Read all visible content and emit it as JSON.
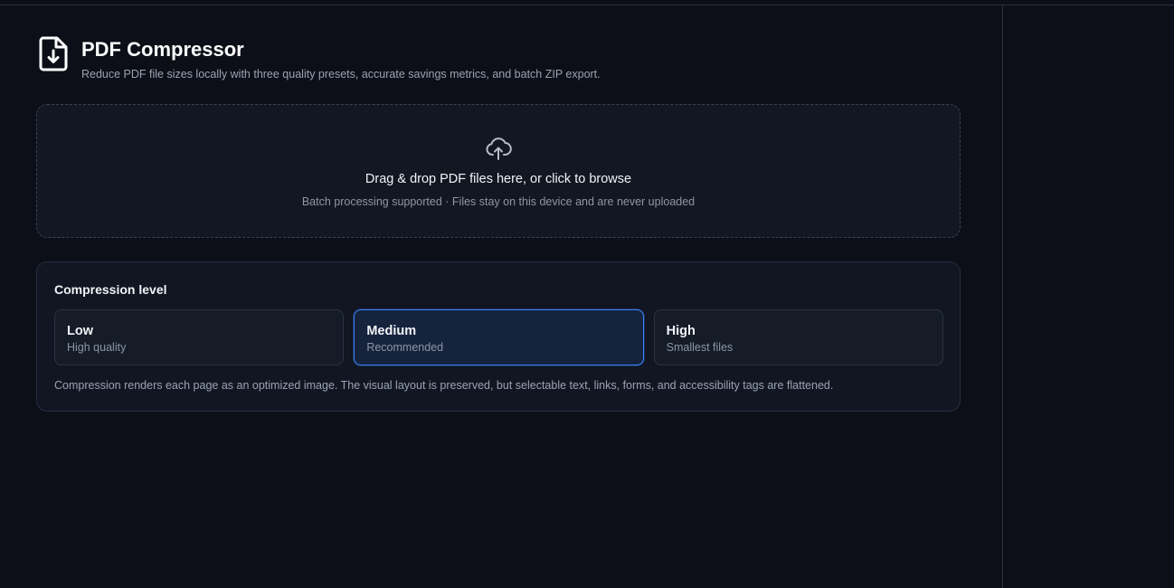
{
  "app": {
    "title": "PDF Compressor",
    "subtitle": "Reduce PDF file sizes locally with three quality presets, accurate savings metrics, and batch ZIP export.",
    "logo_icon": "file-download-icon"
  },
  "dropzone": {
    "icon": "cloud-upload-icon",
    "title": "Drag & drop PDF files here, or click to browse",
    "hint": "Batch processing supported · Files stay on this device and are never uploaded"
  },
  "compression": {
    "title": "Compression level",
    "options": [
      {
        "label": "Low",
        "description": "High quality",
        "selected": false
      },
      {
        "label": "Medium",
        "description": "Recommended",
        "selected": true
      },
      {
        "label": "High",
        "description": "Smallest files",
        "selected": false
      }
    ],
    "note": "Compression renders each page as an optimized image. The visual layout is preserved, but selectable text, links, forms, and accessibility tags are flattened."
  },
  "colors": {
    "background": "#0c0f17",
    "accent": "#3b82f6",
    "text_primary": "#f1f3f7",
    "text_muted": "#9aa3b2"
  }
}
